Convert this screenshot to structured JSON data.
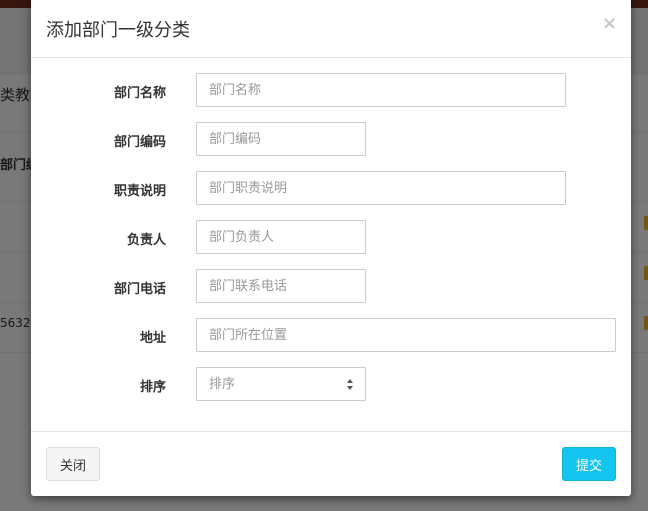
{
  "background": {
    "title_fragment": "类教学",
    "column_fragment": "部门编",
    "cell_fragment": "5632"
  },
  "modal": {
    "title": "添加部门一级分类",
    "close_label": "×",
    "fields": {
      "name": {
        "label": "部门名称",
        "placeholder": "部门名称"
      },
      "code": {
        "label": "部门编码",
        "placeholder": "部门编码"
      },
      "desc": {
        "label": "职责说明",
        "placeholder": "部门职责说明"
      },
      "owner": {
        "label": "负责人",
        "placeholder": "部门负责人"
      },
      "phone": {
        "label": "部门电话",
        "placeholder": "部门联系电话"
      },
      "address": {
        "label": "地址",
        "placeholder": "部门所在位置"
      },
      "sort": {
        "label": "排序",
        "placeholder": "排序"
      }
    },
    "footer": {
      "close_button": "关闭",
      "submit_button": "提交"
    }
  },
  "colors": {
    "primary": "#13c4ee",
    "topbar": "#6d2a1f",
    "accent_orange": "#f0a83a"
  }
}
